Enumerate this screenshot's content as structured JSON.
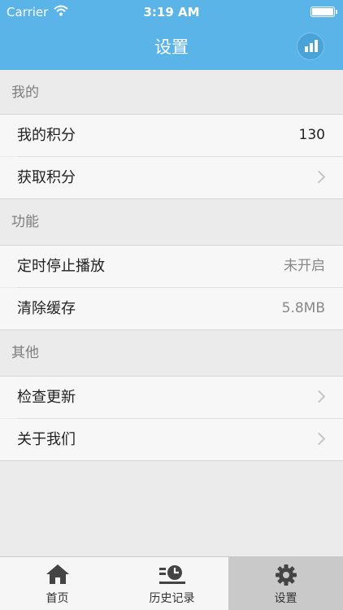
{
  "status_bar": {
    "carrier": "Carrier",
    "time": "3:19 AM"
  },
  "nav": {
    "title": "设置",
    "stats_icon": "bar-chart-icon"
  },
  "sections": [
    {
      "header": "我的",
      "rows": [
        {
          "label": "我的积分",
          "value": "130"
        },
        {
          "label": "获取积分",
          "value": ""
        }
      ]
    },
    {
      "header": "功能",
      "rows": [
        {
          "label": "定时停止播放",
          "value": "未开启"
        },
        {
          "label": "清除缓存",
          "value": "5.8MB"
        }
      ]
    },
    {
      "header": "其他",
      "rows": [
        {
          "label": "检查更新",
          "value": ""
        },
        {
          "label": "关于我们",
          "value": ""
        }
      ]
    }
  ],
  "tabs": [
    {
      "label": "首页",
      "icon": "home-icon"
    },
    {
      "label": "历史记录",
      "icon": "history-icon"
    },
    {
      "label": "设置",
      "icon": "gear-icon",
      "active": true
    }
  ],
  "colors": {
    "nav_bg": "#5ab4e8",
    "page_bg": "#ebebeb",
    "row_bg": "#f7f7f7",
    "active_tab_bg": "#c9c9c9"
  }
}
